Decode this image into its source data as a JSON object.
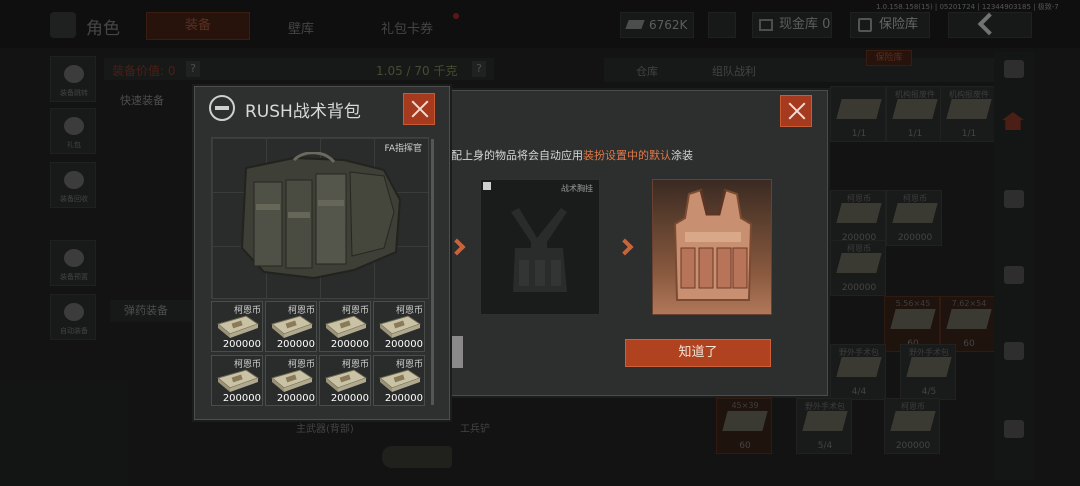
{
  "version": "1.0.158.158(15) | 05201724 | 12344903185 | 极致-7",
  "topbar": {
    "title": "角色",
    "tabs": [
      "装备",
      "壁库",
      "礼包卡券"
    ],
    "currency": "6762K",
    "cash_btn": "现金库 0",
    "safe_btn": "保险库",
    "safe_tag": "保险库"
  },
  "left_panel": {
    "weight_label": "装备价值: 0",
    "weight_value": "1.05 / 70 千克",
    "help": "?",
    "quick_equip": "快速装备",
    "ammo_equip": "弹药装备",
    "sidebar": [
      "装备跳转",
      "礼包",
      "装备回收",
      "装备预置",
      "自动装备"
    ],
    "bottom_labels": [
      "主武器(背部)",
      "工兵铲"
    ]
  },
  "right_panel": {
    "tabs": [
      "仓库",
      "组队战利"
    ],
    "cells": [
      {
        "label": "",
        "num": "1/1"
      },
      {
        "label": "机构报废件",
        "num": "1/1"
      },
      {
        "label": "机构报废件",
        "num": "1/1"
      },
      {
        "label": "机构报废件",
        "num": "1/1"
      },
      {
        "label": "柯恩币",
        "num": "200000"
      },
      {
        "label": "柯恩币",
        "num": "200000"
      },
      {
        "label": "柯恩币",
        "num": "200000"
      },
      {
        "label": "5.56×45",
        "num": "60"
      },
      {
        "label": "7.62×54",
        "num": "60"
      },
      {
        "label": "野外手术包",
        "num": "4/4"
      },
      {
        "label": "野外手术包",
        "num": "4/5"
      },
      {
        "label": "45×39",
        "num": "60"
      },
      {
        "label": "野外手术包",
        "num": "5/4"
      },
      {
        "label": "柯恩币",
        "num": "200000"
      }
    ]
  },
  "skin_dialog": {
    "notice_prefix": "配上身的物品将会自动应用",
    "notice_highlight": "装扮设置中的默认",
    "notice_suffix": "涂装",
    "current_tag": "战术胸挂",
    "ok_button": "知道了"
  },
  "pack_dialog": {
    "title": "RUSH战术背包",
    "preview_tag": "FA指挥官",
    "slots": [
      {
        "label": "柯恩币",
        "num": "200000"
      },
      {
        "label": "柯恩币",
        "num": "200000"
      },
      {
        "label": "柯恩币",
        "num": "200000"
      },
      {
        "label": "柯恩币",
        "num": "200000"
      },
      {
        "label": "柯恩币",
        "num": "200000"
      },
      {
        "label": "柯恩币",
        "num": "200000"
      },
      {
        "label": "柯恩币",
        "num": "200000"
      },
      {
        "label": "柯恩币",
        "num": "200000"
      }
    ]
  },
  "colors": {
    "accent": "#b0421f",
    "highlight": "#e07a4a",
    "panel": "#2e2f2f"
  }
}
